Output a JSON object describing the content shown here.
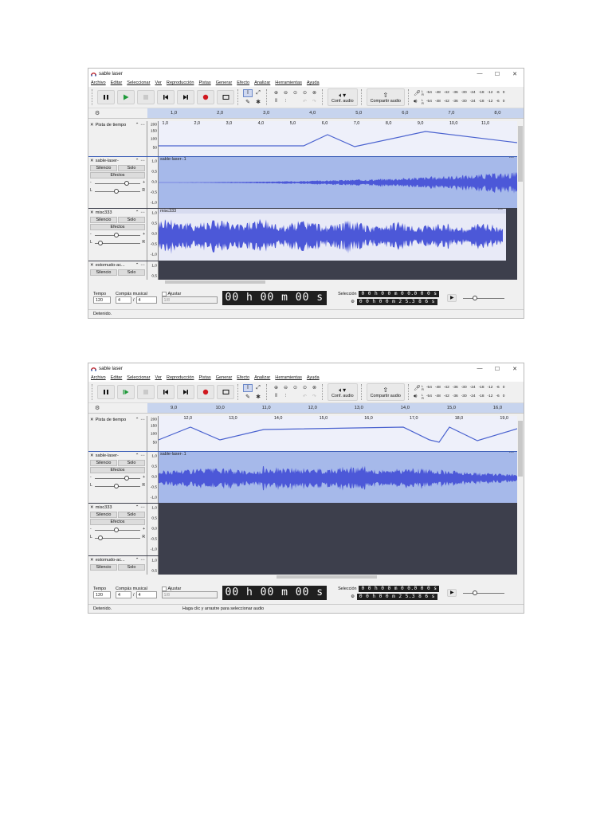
{
  "colors": {
    "accent": "#3a5db7",
    "waveform": "#4c58d8",
    "track_bg_selected": "#a6b9ea",
    "track_bg": "#3d3f4c",
    "clip_white": "#e8eaf7"
  },
  "window": {
    "title": "sable laser",
    "menu": [
      "Archivo",
      "Editar",
      "Seleccionar",
      "Ver",
      "Reproducción",
      "Pistas",
      "Generar",
      "Efecto",
      "Analizar",
      "Herramientas",
      "Ayuda"
    ],
    "controls": [
      "—",
      "☐",
      "✕"
    ]
  },
  "toolbar": {
    "audio_setup_label": "Conf. audio",
    "share_label": "Compartir audio",
    "meter_scale": [
      "-54",
      "-48",
      "-42",
      "-36",
      "-30",
      "-24",
      "-18",
      "-12",
      "-6",
      "0"
    ],
    "meter_channels": [
      "L",
      "R"
    ]
  },
  "tracks": {
    "timeline_name": "Pista de tiempo",
    "timeline_scale": [
      "200",
      "150",
      "100",
      "50"
    ],
    "audio_scale": [
      "1,0",
      "0,5",
      "0,0",
      "-0,5",
      "-1,0"
    ],
    "mute_label": "Silencio",
    "solo_label": "Solo",
    "effects_label": "Efectos",
    "pan_left": "L",
    "pan_right": "R",
    "gain_minus": "-",
    "gain_plus": "+",
    "clip_menu": "•••",
    "track_names": [
      "sable-laser-",
      "misc333",
      "estomudo-ac..."
    ],
    "clip_names": [
      "sable-laser-.1",
      "misc333"
    ]
  },
  "bottom": {
    "tempo_label": "Tempo",
    "tempo_value": "120",
    "signature_label": "Compás musical",
    "signature_num": "4",
    "signature_sep": "/",
    "signature_den": "4",
    "snap_label": "Ajustar",
    "snap_value": "1/8",
    "time_display": "00 h 00 m 00 s",
    "selection_label": "Selección",
    "sel_start": "0 0 h 0 0 m 0 0.0 0 0 s",
    "sel_end": "0 0 h 0 0 m 2 5.3 8 6 s"
  },
  "screens": [
    {
      "ruler_ticks": [
        "1,0",
        "2,0",
        "3,0",
        "4,0",
        "5,0",
        "6,0",
        "7,0",
        "8,0"
      ],
      "timeline_ticks": [
        "1,0",
        "2,0",
        "3,0",
        "4,0",
        "5,0",
        "6,0",
        "7,0",
        "8,0",
        "9,0",
        "10,0",
        "11,0"
      ],
      "status_left": "Detenido.",
      "status_hint": ""
    },
    {
      "ruler_ticks": [
        "9,0",
        "10,0",
        "11,0",
        "12,0",
        "13,0",
        "14,0",
        "15,0",
        "16,0"
      ],
      "timeline_ticks": [
        "12,0",
        "13,0",
        "14,0",
        "15,0",
        "16,0",
        "17,0",
        "18,0",
        "19,0"
      ],
      "status_left": "Detenido.",
      "status_hint": "Haga clic y arrastre para seleccionar audio"
    }
  ]
}
